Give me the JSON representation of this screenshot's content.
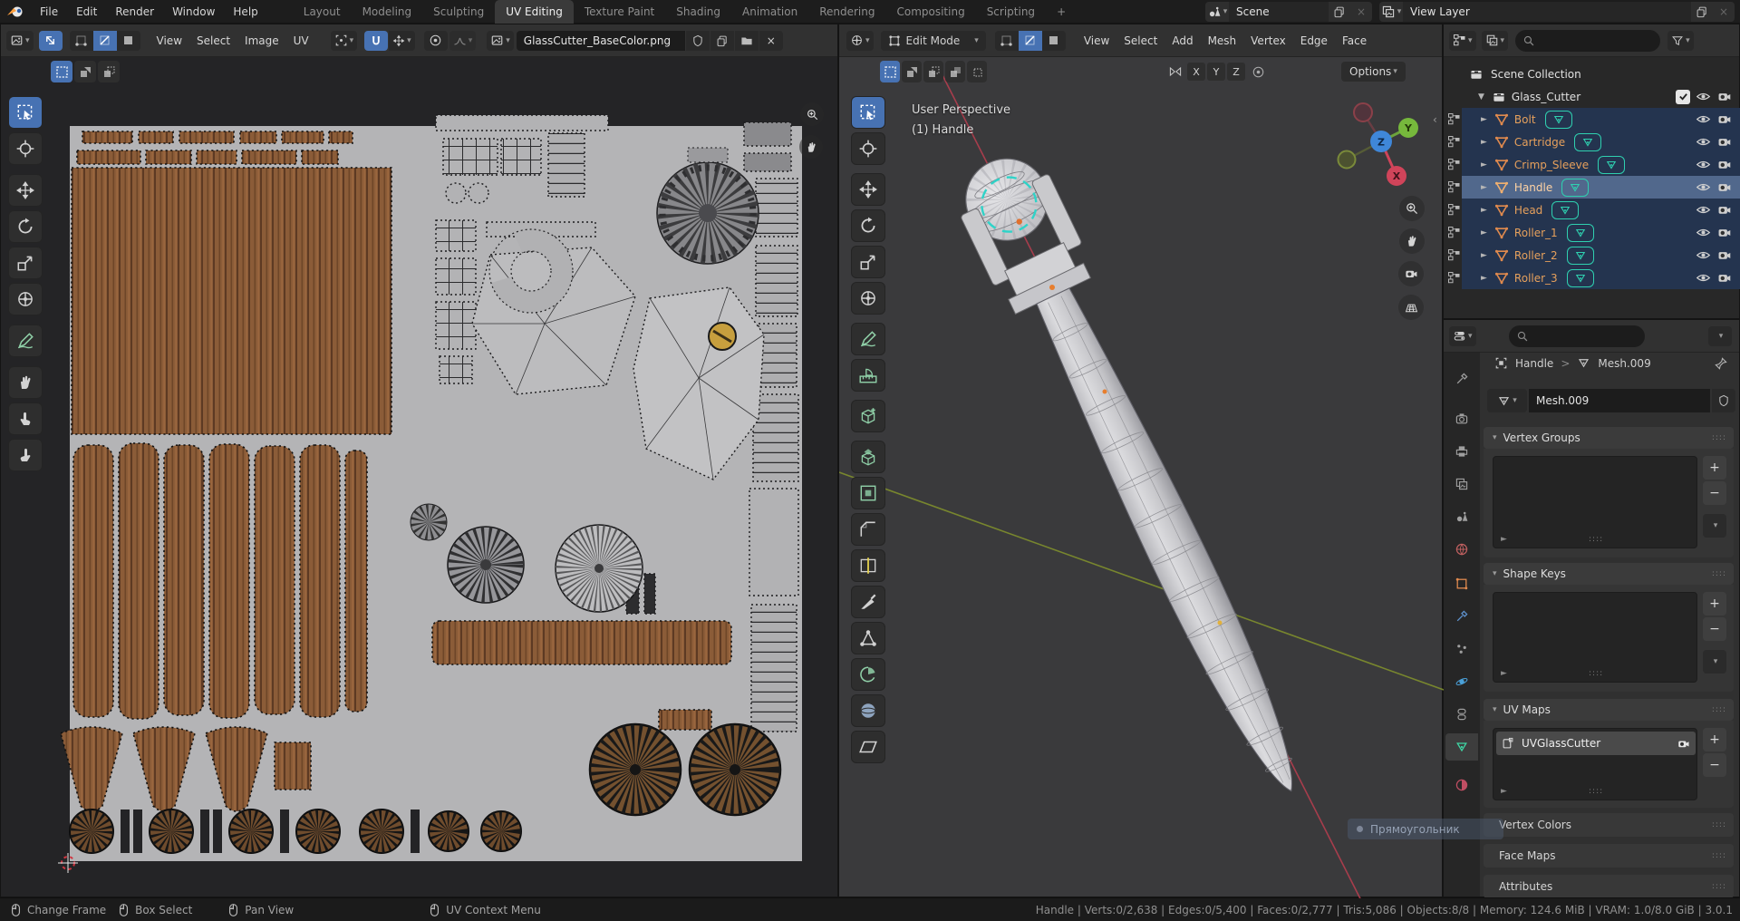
{
  "topbar": {
    "menus": [
      "File",
      "Edit",
      "Render",
      "Window",
      "Help"
    ],
    "tabs": [
      "Layout",
      "Modeling",
      "Sculpting",
      "UV Editing",
      "Texture Paint",
      "Shading",
      "Animation",
      "Rendering",
      "Compositing",
      "Scripting"
    ],
    "active_tab": "UV Editing",
    "add_tab": "+",
    "scene": {
      "label": "Scene"
    },
    "view_layer": {
      "label": "View Layer"
    }
  },
  "uv_editor": {
    "menus": [
      "View",
      "Select",
      "Image",
      "UV"
    ],
    "image_name": "GlassCutter_BaseColor.png",
    "tools": [
      "select-box",
      "cursor",
      "move",
      "rotate",
      "scale",
      "transform",
      "annotate",
      "grab",
      "relax",
      "pinch"
    ]
  },
  "viewport": {
    "mode": "Edit Mode",
    "menus": [
      "View",
      "Select",
      "Add",
      "Mesh",
      "Vertex",
      "Edge",
      "Face"
    ],
    "axis_toggles": [
      "X",
      "Y",
      "Z"
    ],
    "options": "Options",
    "overlay": {
      "line1": "User Perspective",
      "line2": "(1) Handle"
    },
    "gizmo": {
      "x": "X",
      "y": "Y",
      "z": "Z"
    },
    "tools": [
      "select-box",
      "cursor",
      "move",
      "rotate",
      "scale",
      "transform",
      "annotate",
      "measure",
      "add-cube",
      "extrude",
      "inset",
      "bevel",
      "loop-cut",
      "knife",
      "poly-build",
      "spin",
      "smooth",
      "shear"
    ]
  },
  "outliner": {
    "root": "Scene Collection",
    "collection": "Glass_Cutter",
    "objects": [
      "Bolt",
      "Cartridge",
      "Crimp_Sleeve",
      "Handle",
      "Head",
      "Roller_1",
      "Roller_2",
      "Roller_3"
    ],
    "active_object": "Handle"
  },
  "properties": {
    "breadcrumb": {
      "object": "Handle",
      "data": "Mesh.009"
    },
    "name_field": "Mesh.009",
    "uv_map_item": "UVGlassCutter",
    "sections": {
      "vertex_groups": "Vertex Groups",
      "shape_keys": "Shape Keys",
      "uv_maps": "UV Maps",
      "vertex_colors": "Vertex Colors",
      "face_maps": "Face Maps",
      "attributes": "Attributes"
    }
  },
  "statusbar": {
    "hints": [
      {
        "label": "Change Frame"
      },
      {
        "label": "Box Select"
      },
      {
        "label": "Pan View"
      },
      {
        "label": "UV Context Menu"
      }
    ],
    "stats": "Handle | Verts:0/2,638 | Edges:0/5,400 | Faces:0/2,777 | Tris:5,086 | Objects:8/8 | Memory: 124.6 MiB | VRAM: 1.0/8.0 GiB | 3.0.1"
  },
  "tooltip": {
    "text": "Прямоугольник"
  },
  "icons": {
    "chev_down": "▾",
    "tri_right": "►",
    "tri_down": "▼",
    "collapse": "‹",
    "plus": "+",
    "minus": "−",
    "close": "×",
    "gt": ">"
  },
  "colors": {
    "accent": "#4772b3",
    "object_name": "#e6a05c",
    "mesh_data_teal": "#2fd0b0",
    "axis_x": "#d0445a",
    "axis_y": "#7f8f2d",
    "axis_z": "#3f87d9",
    "wood": "#8b5c38"
  }
}
